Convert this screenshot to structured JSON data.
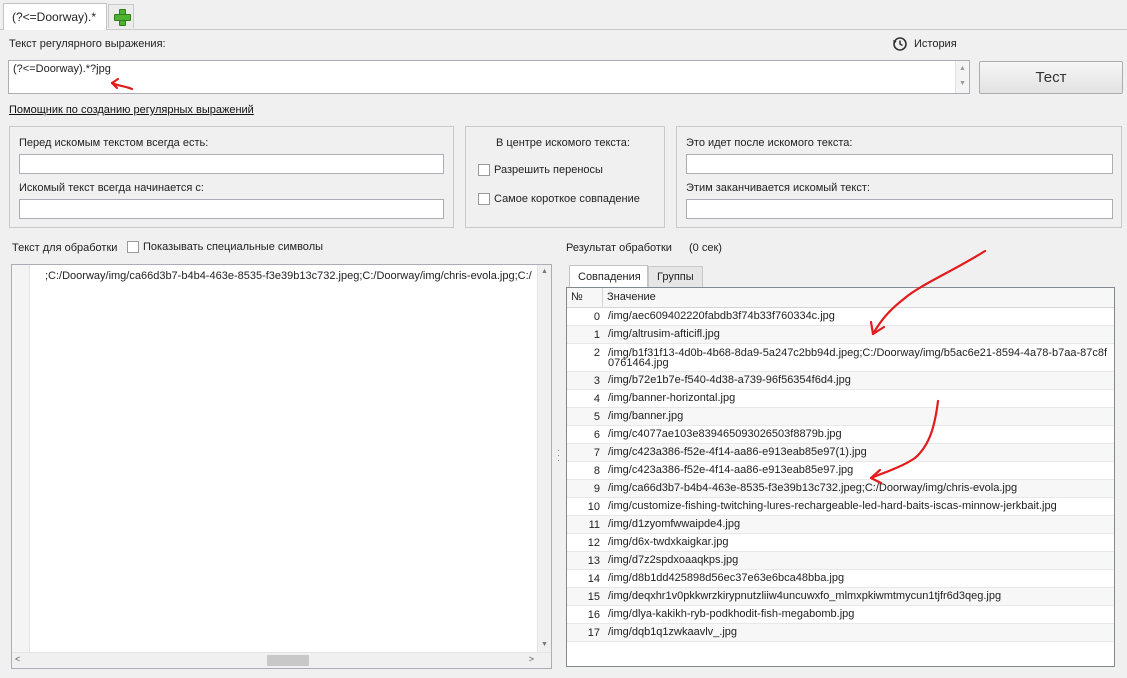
{
  "tabs": {
    "active_label": "(?<=Doorway).*"
  },
  "regex": {
    "label": "Текст регулярного выражения:",
    "history_label": "История",
    "value": "(?<=Doorway).*?jpg",
    "test_button": "Тест",
    "helper_link": "Помощник по созданию регулярных выражений"
  },
  "helper": {
    "before_label": "Перед искомым текстом всегда есть:",
    "starts_label": "Искомый текст всегда начинается с:",
    "center_title": "В центре искомого текста:",
    "allow_breaks": "Разрешить переносы",
    "shortest_match": "Самое короткое совпадение",
    "after_label": "Это идет после искомого текста:",
    "ends_label": "Этим заканчивается искомый текст:"
  },
  "source": {
    "label": "Текст для обработки",
    "show_special": "Показывать специальные символы",
    "text": ";C:/Doorway/img/ca66d3b7-b4b4-463e-8535-f3e39b13c732.jpeg;C:/Doorway/img/chris-evola.jpg;C:/"
  },
  "result": {
    "label": "Результат обработки",
    "time": "(0 сек)",
    "tab_matches": "Совпадения",
    "tab_groups": "Группы",
    "col_num": "№",
    "col_value": "Значение",
    "rows": [
      {
        "n": "0",
        "v": "/img/aec609402220fabdb3f74b33f760334c.jpg"
      },
      {
        "n": "1",
        "v": "/img/altrusim-afticifl.jpg"
      },
      {
        "n": "2",
        "v": "/img/b1f31f13-4d0b-4b68-8da9-5a247c2bb94d.jpeg;C:/Doorway/img/b5ac6e21-8594-4a78-b7aa-87c8f0761464.jpg"
      },
      {
        "n": "3",
        "v": "/img/b72e1b7e-f540-4d38-a739-96f56354f6d4.jpg"
      },
      {
        "n": "4",
        "v": "/img/banner-horizontal.jpg"
      },
      {
        "n": "5",
        "v": "/img/banner.jpg"
      },
      {
        "n": "6",
        "v": "/img/c4077ae103e839465093026503f8879b.jpg"
      },
      {
        "n": "7",
        "v": "/img/c423a386-f52e-4f14-aa86-e913eab85e97(1).jpg"
      },
      {
        "n": "8",
        "v": "/img/c423a386-f52e-4f14-aa86-e913eab85e97.jpg"
      },
      {
        "n": "9",
        "v": "/img/ca66d3b7-b4b4-463e-8535-f3e39b13c732.jpeg;C:/Doorway/img/chris-evola.jpg"
      },
      {
        "n": "10",
        "v": "/img/customize-fishing-twitching-lures-rechargeable-led-hard-baits-iscas-minnow-jerkbait.jpg"
      },
      {
        "n": "11",
        "v": "/img/d1zyomfwwaipde4.jpg"
      },
      {
        "n": "12",
        "v": "/img/d6x-twdxkaigkar.jpg"
      },
      {
        "n": "13",
        "v": "/img/d7z2spdxoaaqkps.jpg"
      },
      {
        "n": "14",
        "v": "/img/d8b1dd425898d56ec37e63e6bca48bba.jpg"
      },
      {
        "n": "15",
        "v": "/img/deqxhr1v0pkkwrzkirypnutzliiw4uncuwxfo_mlmxpkiwmtmycun1tjfr6d3qeg.jpg"
      },
      {
        "n": "16",
        "v": "/img/dlya-kakikh-ryb-podkhodit-fish-megabomb.jpg"
      },
      {
        "n": "17",
        "v": "/img/dqb1q1zwkaavlv_.jpg"
      }
    ]
  },
  "colors": {
    "annotation": "#e31b1b",
    "grid_border": "#828790"
  }
}
